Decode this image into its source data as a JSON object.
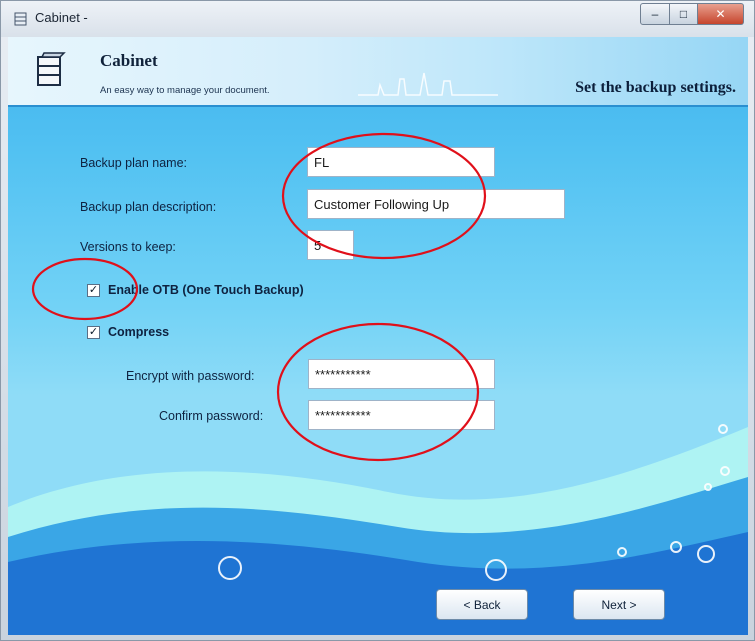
{
  "window": {
    "title": "Cabinet -",
    "controls": {
      "minimize": "–",
      "maximize": "□",
      "close": "✕"
    }
  },
  "header": {
    "app_name": "Cabinet",
    "tagline": "An easy way to manage your document.",
    "step_title": "Set the backup settings."
  },
  "form": {
    "plan_name": {
      "label": "Backup plan name:",
      "value": "FL"
    },
    "plan_description": {
      "label": "Backup plan description:",
      "value": "Customer Following Up"
    },
    "versions": {
      "label": "Versions to keep:",
      "value": "5"
    },
    "enable_otb": {
      "label": "Enable OTB (One Touch Backup)",
      "checked": true,
      "mark": "✓"
    },
    "compress": {
      "label": "Compress",
      "checked": true,
      "mark": "✓"
    },
    "encrypt_password": {
      "label": "Encrypt with password:",
      "value": "***********"
    },
    "confirm_password": {
      "label": "Confirm password:",
      "value": "***********"
    }
  },
  "buttons": {
    "back": "< Back",
    "next": "Next >"
  },
  "icons": {
    "window_icon": "cabinet-icon",
    "app_icon": "cabinet-icon",
    "skyline": "skyline-decoration",
    "bubbles": "bubble-decoration"
  },
  "colors": {
    "header_bg": "#d5eefb",
    "body_bg": "#53c2f2",
    "wave_light": "#9ef0f2",
    "wave_dark": "#1e6fd0",
    "annotation_red": "#e0101a"
  }
}
